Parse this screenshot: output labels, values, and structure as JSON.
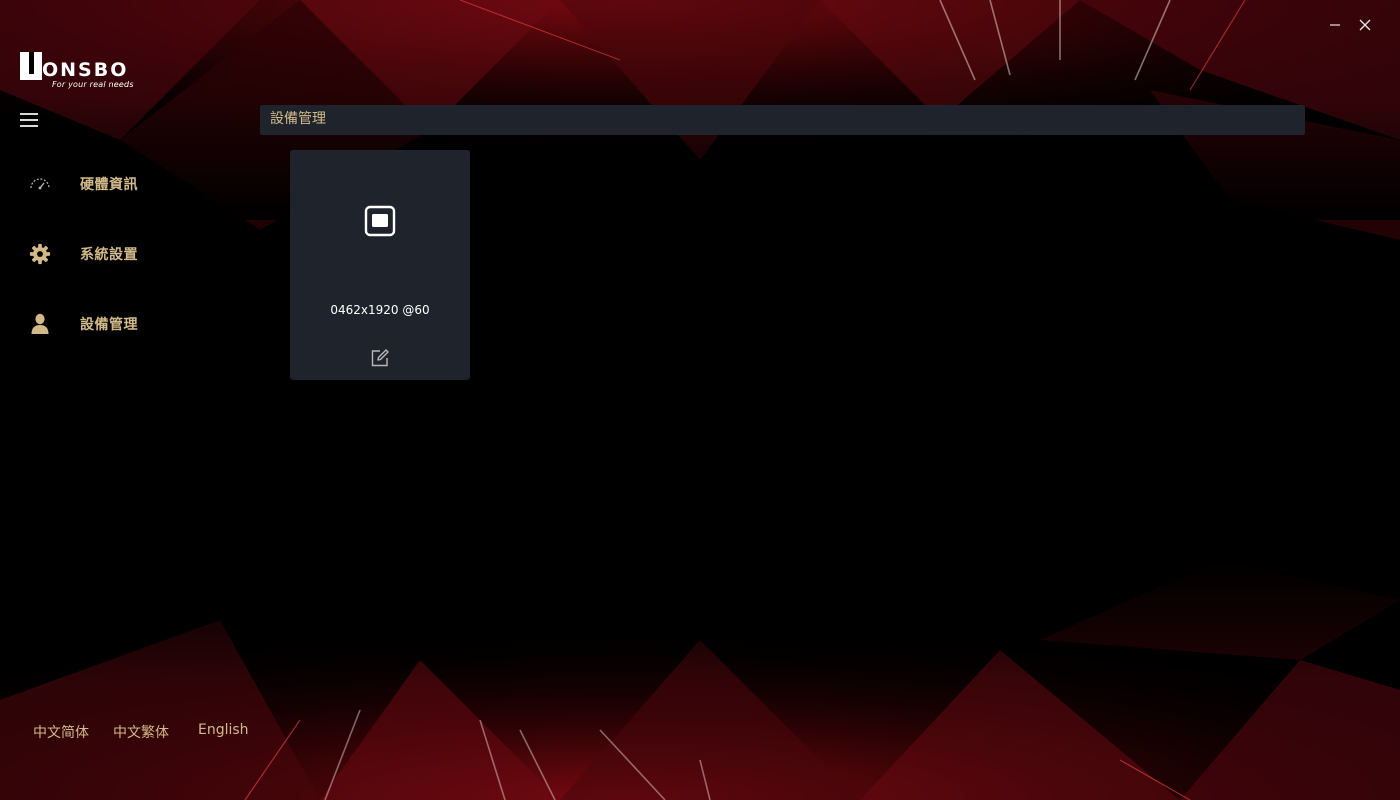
{
  "logo": {
    "brand": "ONSBO",
    "tagline": "For your real needs"
  },
  "nav": {
    "items": [
      {
        "label": "硬體資訊",
        "icon": "speedometer-icon"
      },
      {
        "label": "系統設置",
        "icon": "gear-icon"
      },
      {
        "label": "設備管理",
        "icon": "user-icon"
      }
    ]
  },
  "content": {
    "title": "設備管理",
    "device": {
      "resolution": "0462x1920 @60",
      "icon": "display-icon",
      "edit_icon": "edit-icon"
    }
  },
  "languages": [
    "中文简体",
    "中文繁体",
    "English"
  ],
  "colors": {
    "accent_gold": "#d2b98a",
    "panel": "#1f242c",
    "background": "#000000",
    "red_glow": "#b0101a"
  }
}
